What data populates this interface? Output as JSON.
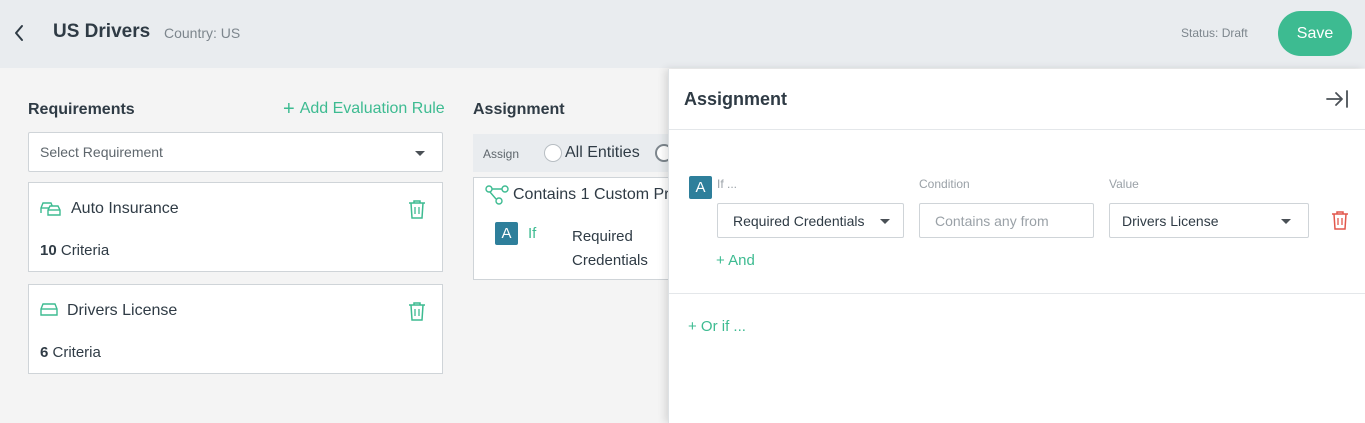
{
  "header": {
    "title": "US Drivers",
    "country": "Country: US",
    "status": "Status: Draft",
    "save_label": "Save"
  },
  "requirements": {
    "title": "Requirements",
    "add_rule_label": "Add Evaluation Rule",
    "select_placeholder": "Select Requirement",
    "items": [
      {
        "name": "Auto Insurance",
        "count": "10",
        "criteria_label": "Criteria",
        "icon": "cars-icon"
      },
      {
        "name": "Drivers License",
        "count": "6",
        "criteria_label": "Criteria",
        "icon": "car-icon"
      }
    ]
  },
  "assignment": {
    "title": "Assignment",
    "assign_label": "Assign",
    "all_entities_label": "All Entities",
    "rule": {
      "heading": "Contains 1 Custom Pr",
      "badge": "A",
      "if_label": "If",
      "field_line1": "Required",
      "field_line2": "Credentials"
    }
  },
  "panel": {
    "title": "Assignment",
    "badge": "A",
    "if_label": "If ...",
    "condition_label": "Condition",
    "value_label": "Value",
    "field_value": "Required Credentials",
    "condition_placeholder": "Contains any from",
    "value_value": "Drivers License",
    "and_label": "+ And",
    "or_label": "+ Or if ..."
  },
  "colors": {
    "accent": "#3dbb91",
    "badge": "#2e7f9b",
    "danger": "#e2574c",
    "header_bg": "#e9ecef"
  }
}
